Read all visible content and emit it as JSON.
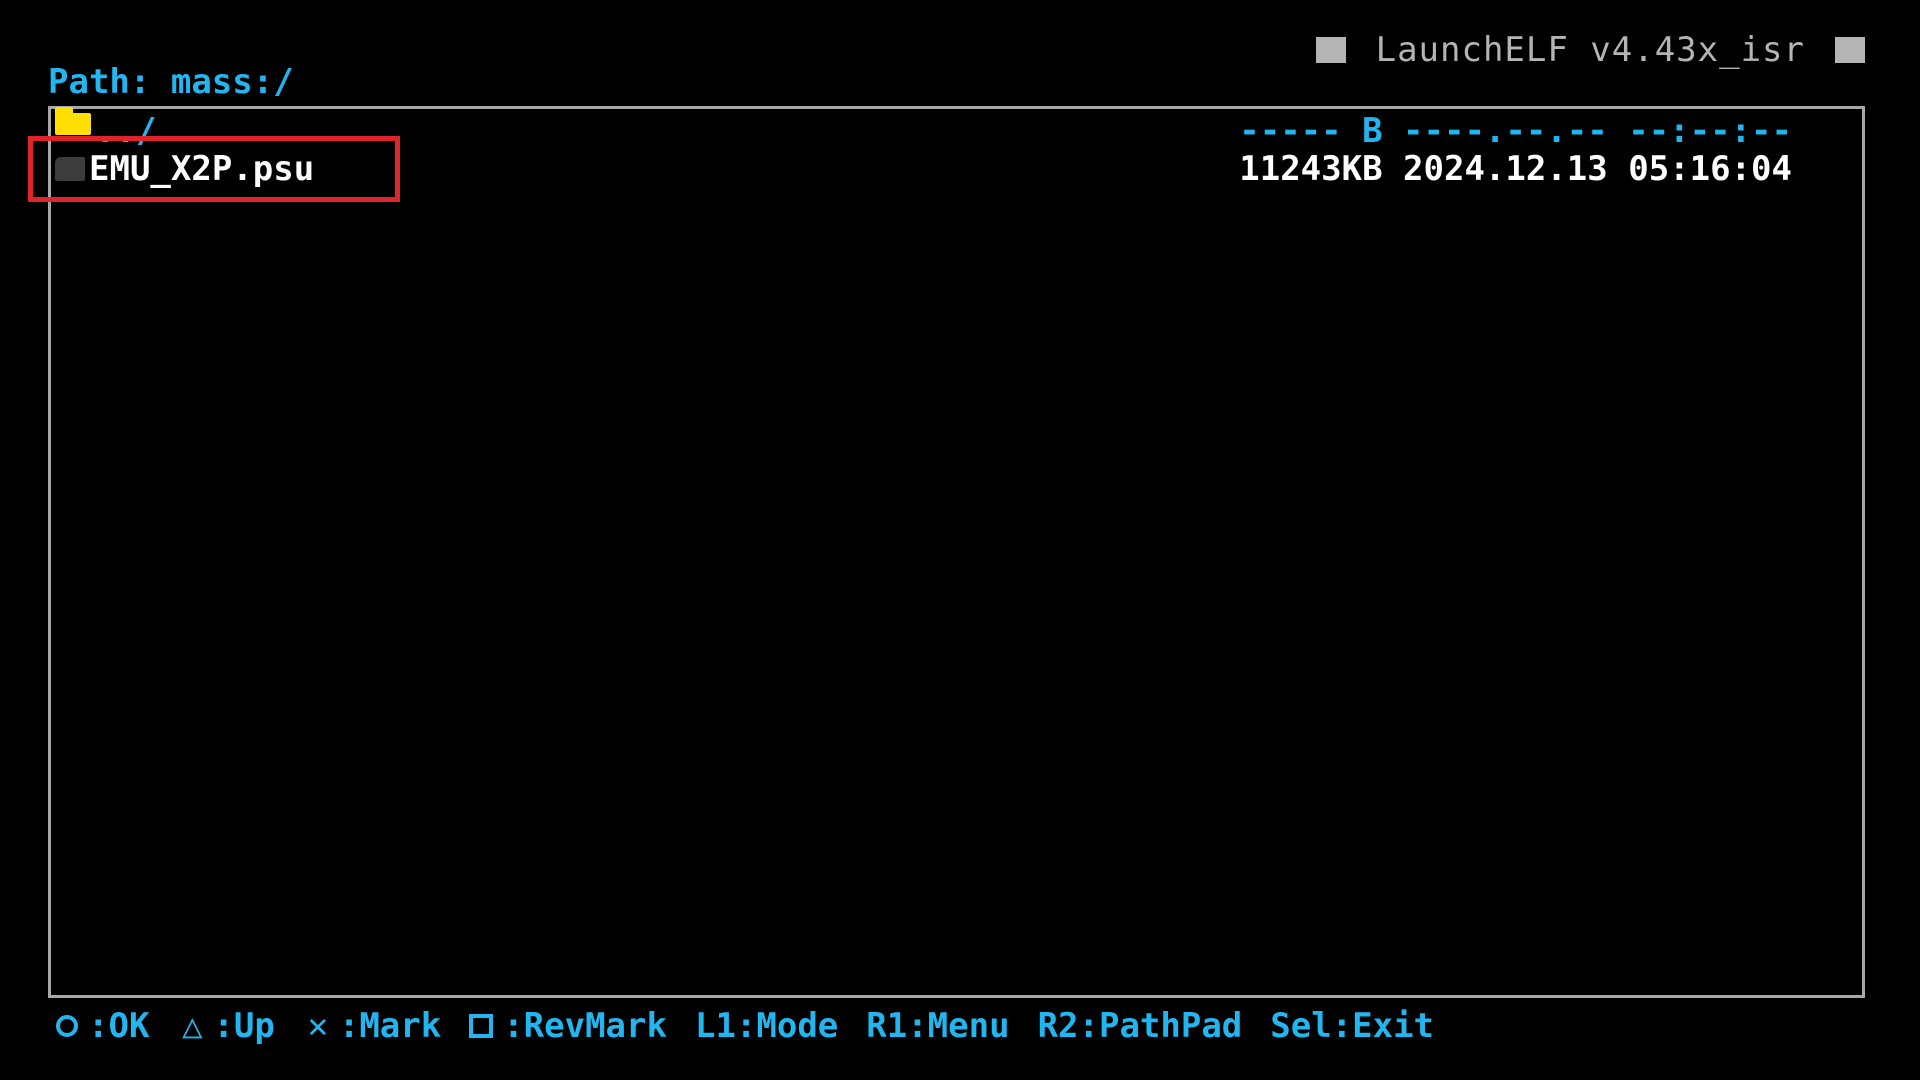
{
  "header": {
    "app_title": "LaunchELF v4.43x_isr",
    "path_label": "Path:",
    "path_value": "mass:/"
  },
  "file_list": {
    "parent_entry": {
      "name": "../",
      "size": "----- B",
      "date": "----.--.--",
      "time": "--:--:--"
    },
    "entries": [
      {
        "name": "EMU_X2P.psu",
        "size": "11243KB",
        "date": "2024.12.13",
        "time": "05:16:04"
      }
    ]
  },
  "footer": {
    "hints": [
      {
        "glyph": "circle",
        "label": ":OK"
      },
      {
        "glyph": "△",
        "label": ":Up"
      },
      {
        "glyph": "✕",
        "label": ":Mark"
      },
      {
        "glyph": "square",
        "label": ":RevMark"
      },
      {
        "glyph": "",
        "label": "L1:Mode"
      },
      {
        "glyph": "",
        "label": "R1:Menu"
      },
      {
        "glyph": "",
        "label": "R2:PathPad"
      },
      {
        "glyph": "",
        "label": "Sel:Exit"
      }
    ]
  },
  "colors": {
    "accent": "#22b6f0",
    "title_gray": "#b4b4b4",
    "frame_gray": "#a8a8a8",
    "folder_yellow": "#ffde00",
    "highlight_red": "#e0242b",
    "file_text": "#ffffff",
    "background": "#000000"
  },
  "icons": {
    "parent_entry": "folder-icon",
    "file_entry": "file-icon"
  }
}
